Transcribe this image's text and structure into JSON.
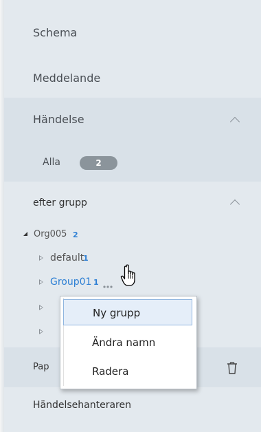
{
  "nav": {
    "schema": "Schema",
    "meddelande": "Meddelande",
    "handelse": "Händelse",
    "alla": "Alla",
    "alla_count": "2",
    "efter_grupp": "efter grupp"
  },
  "tree": {
    "root_label": "Org005",
    "root_count": "2",
    "items": [
      {
        "label": "default",
        "count": "1"
      },
      {
        "label": "Group01",
        "count": "1"
      }
    ]
  },
  "bottom": {
    "pap": "Pap",
    "handelsehanteraren": "Händelsehanteraren"
  },
  "context_menu": {
    "items": [
      "Ny grupp",
      "Ändra namn",
      "Radera"
    ]
  },
  "colors": {
    "panel_bg": "#e3e9ee",
    "section_bg": "#d9e1e8",
    "link_blue": "#2d7fd4",
    "badge_bg": "#8b949b"
  }
}
